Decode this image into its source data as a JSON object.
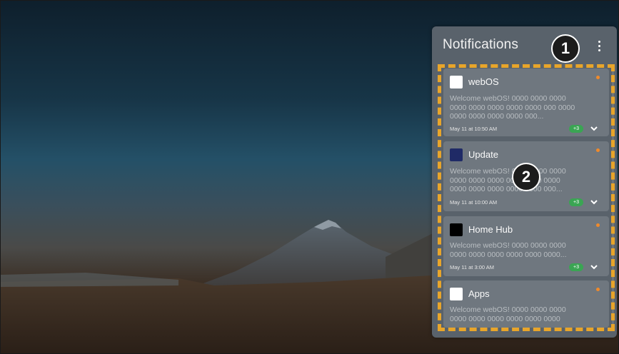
{
  "panel": {
    "title": "Notifications",
    "more_icon": "more-vertical-icon"
  },
  "callouts": [
    "1",
    "2"
  ],
  "highlight_color": "#e8a52a",
  "notifications": [
    {
      "app": "webOS",
      "icon_color": "#ffffff",
      "body": "Welcome webOS! 0000 0000 0000 0000 0000 0000 0000 0000 000 0000 0000 0000 0000 0000 000...",
      "time": "May 11 at 10:50 AM",
      "count": "+3",
      "unread": true
    },
    {
      "app": "Update",
      "icon_color": "#1f2a66",
      "body": "Welcome webOS! 0000 0000 0000 0000 0000 0000 0000 0000 0000 0000 0000 0000 0000 0000 000...",
      "time": "May 11 at 10:00 AM",
      "count": "+3",
      "unread": true
    },
    {
      "app": "Home Hub",
      "icon_color": "#000000",
      "body": "Welcome webOS! 0000 0000 0000 0000 0000 0000 0000 0000 0000...",
      "time": "May 11 at 3:00 AM",
      "count": "+3",
      "unread": true
    },
    {
      "app": "Apps",
      "icon_color": "#ffffff",
      "body": "Welcome webOS! 0000 0000 0000 0000 0000 0000 0000 0000 0000 0000",
      "unread": true
    }
  ]
}
